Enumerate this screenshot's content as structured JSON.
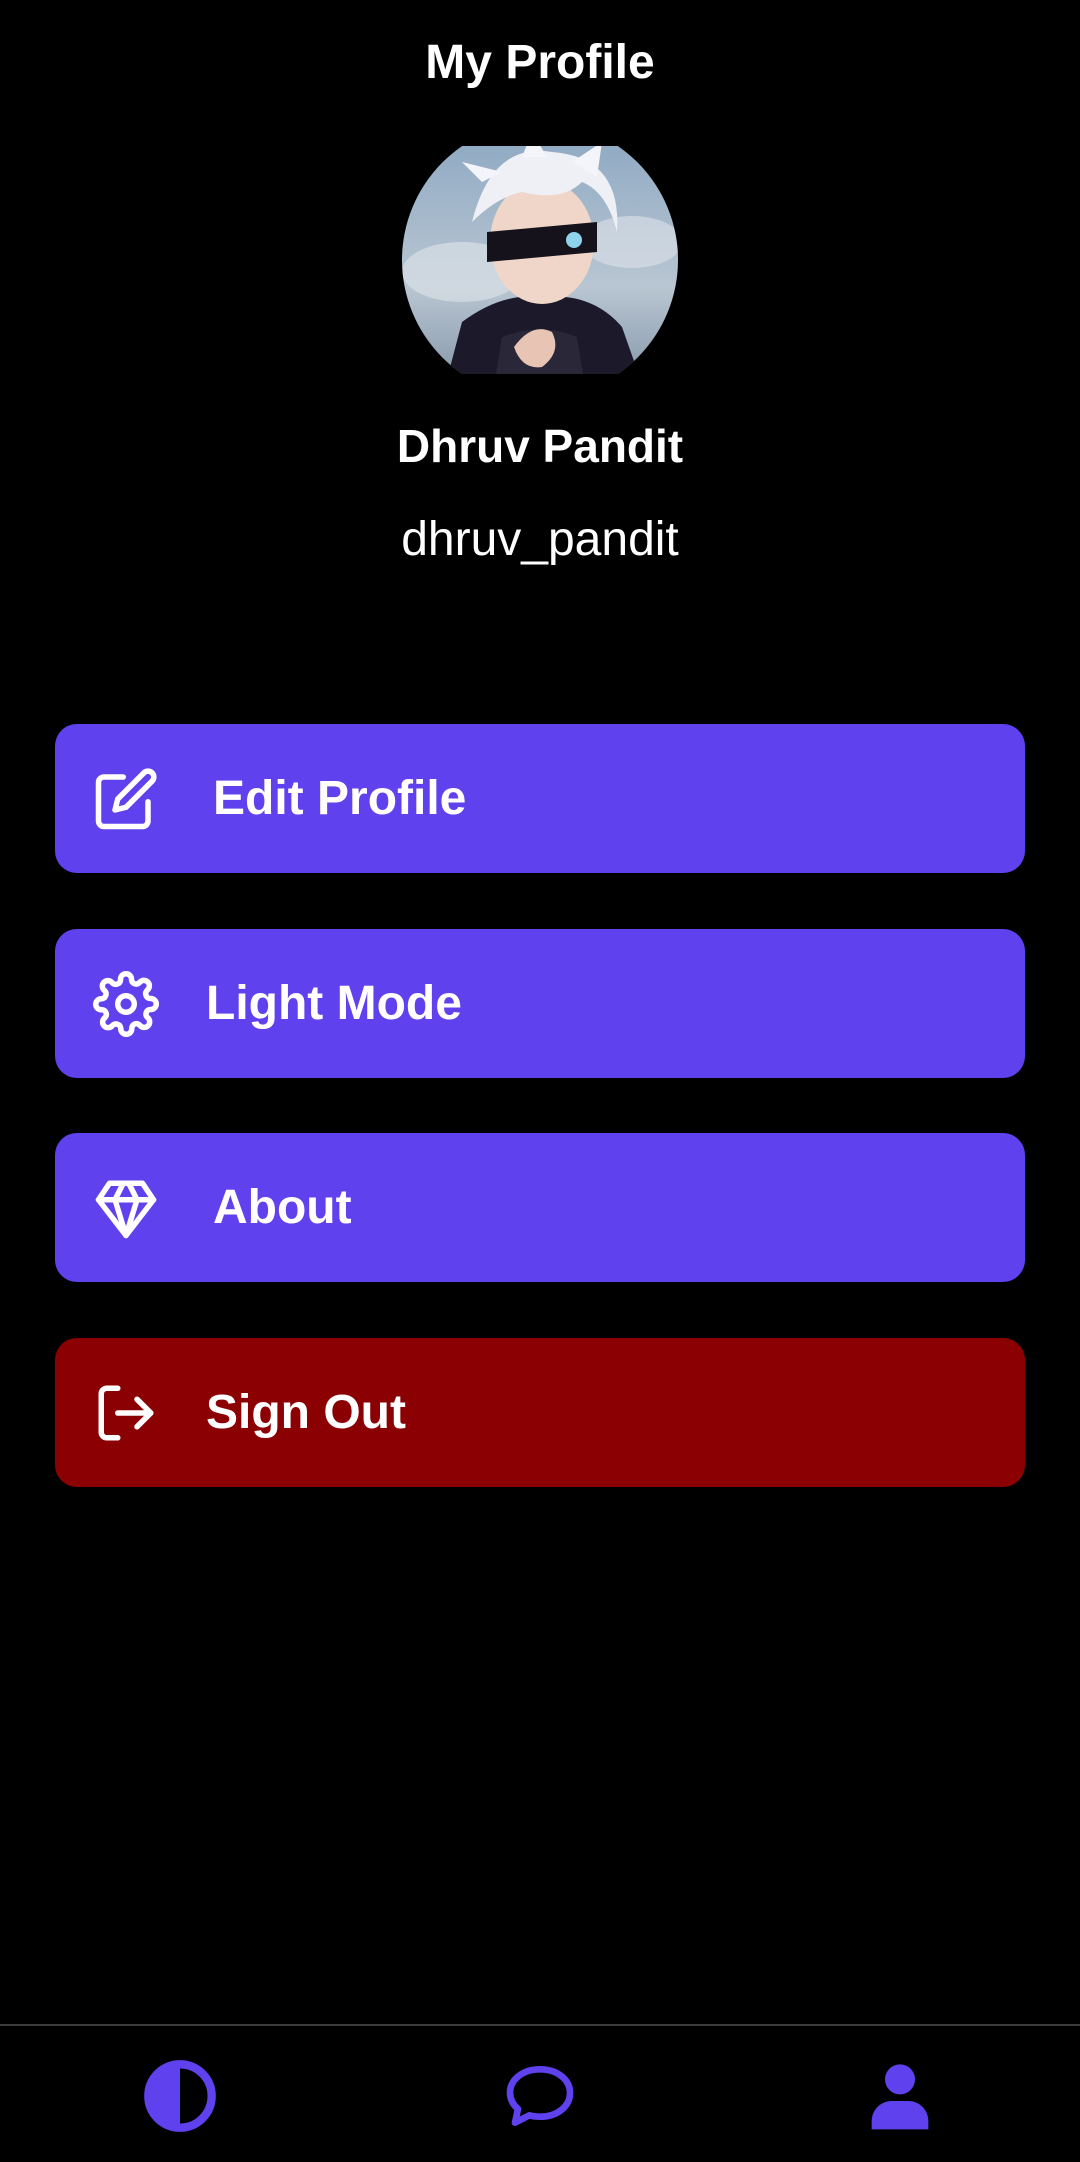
{
  "header": {
    "title": "My Profile"
  },
  "profile": {
    "avatar_icon": "profile-photo",
    "display_name": "Dhruv Pandit",
    "username": "dhruv_pandit"
  },
  "menu": {
    "edit_profile_label": "Edit Profile",
    "light_mode_label": "Light Mode",
    "about_label": "About",
    "sign_out_label": "Sign Out"
  },
  "nav": {
    "items": [
      {
        "icon": "theme-contrast-icon"
      },
      {
        "icon": "chat-bubble-icon"
      },
      {
        "icon": "user-profile-icon"
      }
    ]
  },
  "colors": {
    "accent": "#6041ee",
    "danger": "#8b0002",
    "background": "#000000",
    "text": "#ffffff"
  }
}
